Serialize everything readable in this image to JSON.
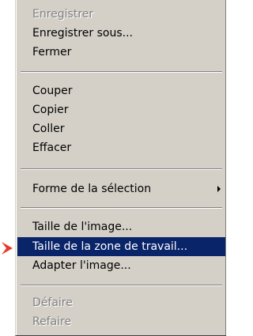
{
  "menu": {
    "items": [
      {
        "label": "Enregistrer"
      },
      {
        "label": "Enregistrer sous..."
      },
      {
        "label": "Fermer"
      },
      {
        "label": "Couper"
      },
      {
        "label": "Copier"
      },
      {
        "label": "Coller"
      },
      {
        "label": "Effacer"
      },
      {
        "label": "Forme de la sélection"
      },
      {
        "label": "Taille de l'image..."
      },
      {
        "label": "Taille de la zone de travail..."
      },
      {
        "label": "Adapter l'image..."
      },
      {
        "label": "Défaire"
      },
      {
        "label": "Refaire"
      }
    ],
    "highlight_color": "#0a246a",
    "background_color": "#d4d0c8",
    "pointer_arrow_color": "#e8382a",
    "submenu_arrow_icon": "triangle-right-icon"
  }
}
